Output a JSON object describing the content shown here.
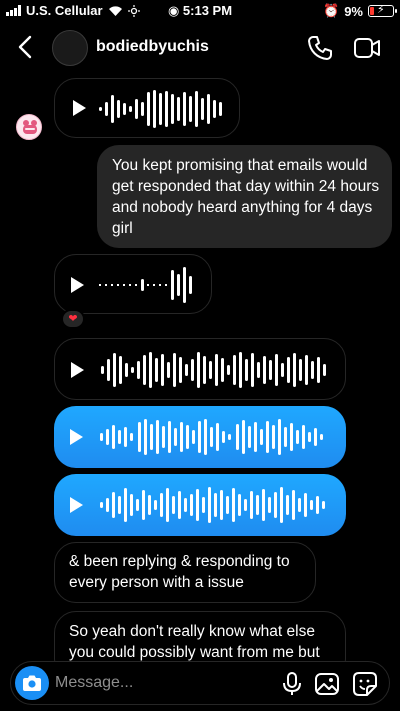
{
  "status_bar": {
    "carrier": "U.S. Cellular",
    "time": "5:13 PM",
    "battery": "9%"
  },
  "header": {
    "username": "bodiedbyuchis"
  },
  "messages": {
    "text_1": "You kept promising that emails would get responded that day within 24 hours and nobody heard anything for 4 days girl",
    "text_2": "& been replying & responding to every person with a issue",
    "text_3": "So yeah don't really know what else you could possibly want from me but"
  },
  "composer": {
    "placeholder": "Message..."
  },
  "icons": {
    "back": "chevron-left-icon",
    "phone": "phone-icon",
    "video": "video-camera-icon",
    "camera": "camera-icon",
    "mic": "microphone-icon",
    "gallery": "image-icon",
    "sticker": "sticker-icon",
    "reaction": "heart-icon"
  },
  "colors": {
    "background": "#000000",
    "incoming_border": "#262626",
    "outgoing_gray": "#262626",
    "outgoing_blue": "#1f97f5",
    "camera_button": "#1a8ff5"
  }
}
